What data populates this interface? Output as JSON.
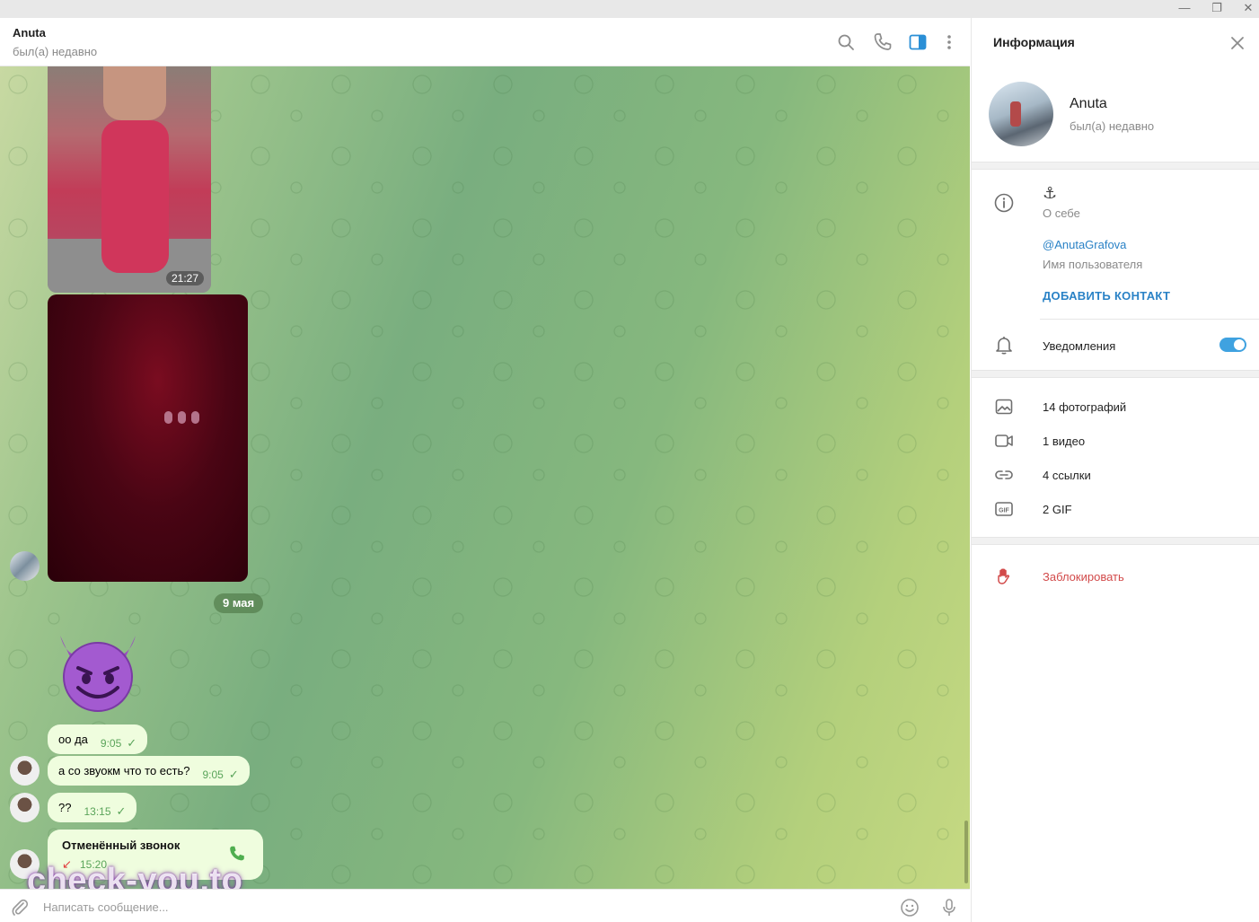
{
  "window": {
    "minimize_glyph": "—",
    "restore_glyph": "❐",
    "close_glyph": "✕"
  },
  "chat": {
    "peer_name": "Anuta",
    "peer_status": "был(а) недавно",
    "header_icons": [
      "search-icon",
      "phone-icon",
      "sidebar-toggle-icon",
      "more-vertical-icon"
    ]
  },
  "messages": {
    "photo1_time": "21:27",
    "date_separator": "9 мая",
    "emoji": "devil-smiling-emoji",
    "texts": [
      {
        "text": "оо да",
        "time": "9:05"
      },
      {
        "text": "а со звуокм что то есть?",
        "time": "9:05"
      },
      {
        "text": "??",
        "time": "13:15"
      }
    ],
    "call": {
      "title": "Отменённый звонок",
      "time": "15:20"
    }
  },
  "watermark": "check-you.to",
  "composer": {
    "placeholder": "Написать сообщение..."
  },
  "info": {
    "title": "Информация",
    "name": "Anuta",
    "status": "был(а) недавно",
    "about_value": "⚓",
    "about_label": "О себе",
    "username": "@AnutaGrafova",
    "username_label": "Имя пользователя",
    "add_contact": "ДОБАВИТЬ КОНТАКТ",
    "notifications_label": "Уведомления",
    "notifications_on": true,
    "media": [
      {
        "icon": "photo-icon",
        "label": "14 фотографий"
      },
      {
        "icon": "video-icon",
        "label": "1 видео"
      },
      {
        "icon": "link-icon",
        "label": "4 ссылки"
      },
      {
        "icon": "gif-icon",
        "label": "2 GIF"
      }
    ],
    "block_label": "Заблокировать",
    "accent_color": "#2a82c6",
    "danger_color": "#d24a4a"
  }
}
